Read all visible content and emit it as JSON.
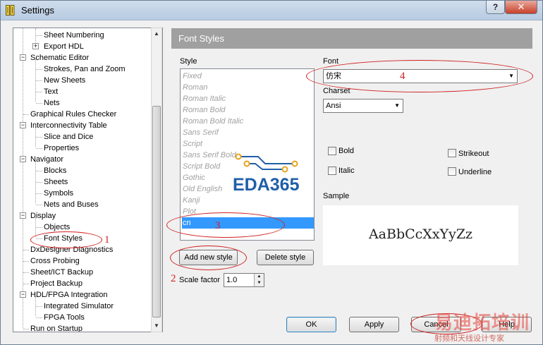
{
  "window": {
    "title": "Settings",
    "help_glyph": "?",
    "close_glyph": "✕"
  },
  "tree": {
    "items": [
      {
        "label": "Sheet Numbering",
        "level": 2,
        "expander": ""
      },
      {
        "label": "Export HDL",
        "level": 1.5,
        "expander": "+"
      },
      {
        "label": "Schematic Editor",
        "level": 1,
        "expander": "−"
      },
      {
        "label": "Strokes, Pan and Zoom",
        "level": 2,
        "expander": ""
      },
      {
        "label": "New Sheets",
        "level": 2,
        "expander": ""
      },
      {
        "label": "Text",
        "level": 2,
        "expander": ""
      },
      {
        "label": "Nets",
        "level": 2,
        "expander": ""
      },
      {
        "label": "Graphical Rules Checker",
        "level": 1,
        "expander": ""
      },
      {
        "label": "Interconnectivity Table",
        "level": 1,
        "expander": "−"
      },
      {
        "label": "Slice and Dice",
        "level": 2,
        "expander": ""
      },
      {
        "label": "Properties",
        "level": 2,
        "expander": ""
      },
      {
        "label": "Navigator",
        "level": 1,
        "expander": "−"
      },
      {
        "label": "Blocks",
        "level": 2,
        "expander": ""
      },
      {
        "label": "Sheets",
        "level": 2,
        "expander": ""
      },
      {
        "label": "Symbols",
        "level": 2,
        "expander": ""
      },
      {
        "label": "Nets and Buses",
        "level": 2,
        "expander": ""
      },
      {
        "label": "Display",
        "level": 1,
        "expander": "−"
      },
      {
        "label": "Objects",
        "level": 2,
        "expander": ""
      },
      {
        "label": "Font Styles",
        "level": 2,
        "expander": ""
      },
      {
        "label": "DxDesigner Diagnostics",
        "level": 1,
        "expander": ""
      },
      {
        "label": "Cross Probing",
        "level": 1,
        "expander": ""
      },
      {
        "label": "Sheet/ICT Backup",
        "level": 1,
        "expander": ""
      },
      {
        "label": "Project Backup",
        "level": 1,
        "expander": ""
      },
      {
        "label": "HDL/FPGA Integration",
        "level": 1,
        "expander": "−"
      },
      {
        "label": "Integrated Simulator",
        "level": 2,
        "expander": ""
      },
      {
        "label": "FPGA Tools",
        "level": 2,
        "expander": ""
      },
      {
        "label": "Run on Startup",
        "level": 1,
        "expander": ""
      }
    ],
    "scroll_up": "▲",
    "scroll_down": "▼"
  },
  "pane": {
    "header": "Font Styles",
    "style_label": "Style",
    "styles": [
      "Fixed",
      "Roman",
      "Roman Italic",
      "Roman Bold",
      "Roman Bold Italic",
      "Sans Serif",
      "Script",
      "Sans Serif Bold",
      "Script Bold",
      "Gothic",
      "Old English",
      "Kanji",
      "Plot",
      "cn"
    ],
    "selected_style": "cn",
    "add_style": "Add new style",
    "delete_style": "Delete style",
    "scale_label": "Scale factor",
    "scale_value": "1.0",
    "font_label": "Font",
    "font_value": "仿宋",
    "charset_label": "Charset",
    "charset_value": "Ansi",
    "bold": "Bold",
    "italic": "Italic",
    "strikeout": "Strikeout",
    "underline": "Underline",
    "sample_label": "Sample",
    "sample_text": "AaBbCcXxYyZz",
    "dropdown_arrow": "▼"
  },
  "footer": {
    "ok": "OK",
    "apply": "Apply",
    "cancel": "Cancel",
    "help": "Help"
  },
  "annotations": {
    "n1": "1",
    "n2": "2",
    "n3": "3",
    "n4": "4"
  },
  "watermark": {
    "logo": "EDA365",
    "site_logo": "易迪拓培训",
    "site_tagline": "射频和天线设计专家"
  },
  "colors": {
    "header_bg": "#a0a0a0",
    "selection": "#3399ff",
    "annotation": "#d02020",
    "logo_blue": "#1f5fa8",
    "logo_orange": "#e8a21f"
  }
}
